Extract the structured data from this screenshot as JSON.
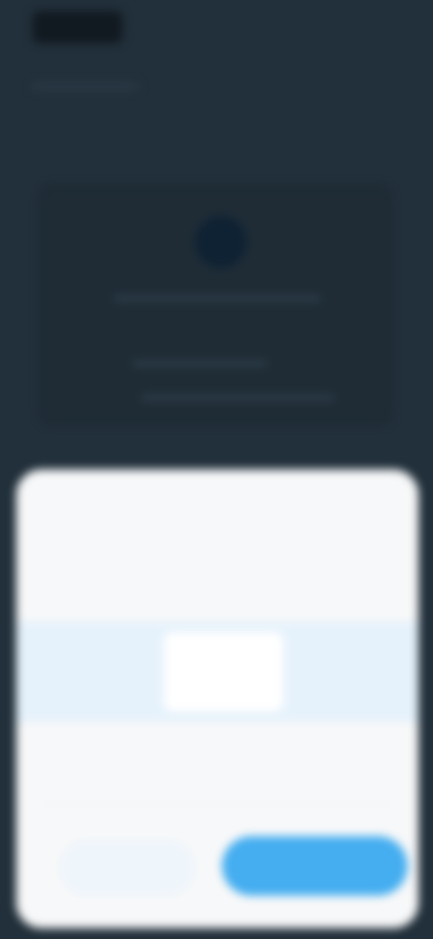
{
  "header": {
    "logo_text": "",
    "nav_link": "",
    "action_button": ""
  },
  "background_card": {
    "line1": "",
    "line2": "",
    "line3": ""
  },
  "modal": {
    "title": "",
    "subtitle": "",
    "plans": [
      {
        "label": "",
        "value": ""
      },
      {
        "label": "",
        "value": ""
      },
      {
        "label": "",
        "value": ""
      }
    ],
    "section_label": "",
    "section_sub": "",
    "section_value": "",
    "cancel_label": "",
    "confirm_label": ""
  },
  "colors": {
    "page_background": "#22303b",
    "sheet_background": "#f7f8f9",
    "accent": "#45aef0",
    "plan_row_background": "#e6f2fb"
  }
}
